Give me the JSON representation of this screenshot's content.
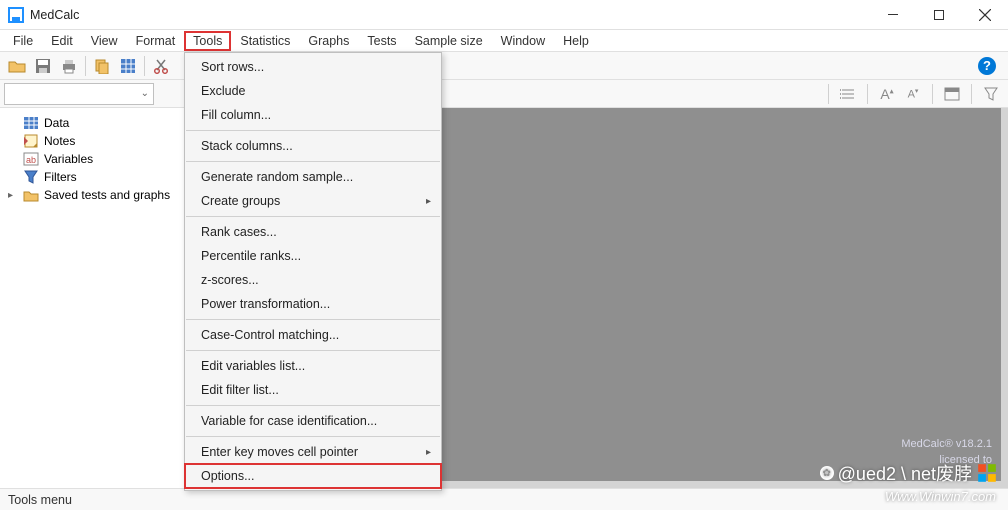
{
  "window": {
    "title": "MedCalc"
  },
  "menubar": {
    "items": [
      "File",
      "Edit",
      "View",
      "Format",
      "Tools",
      "Statistics",
      "Graphs",
      "Tests",
      "Sample size",
      "Window",
      "Help"
    ],
    "highlight_index": 4
  },
  "toolbar": {
    "icons": [
      "open-icon",
      "save-icon",
      "print-icon",
      "copy-icon",
      "paste-icon",
      "grid-icon",
      "cut-icon",
      "chart-icon",
      "undo-icon",
      "redo-icon"
    ],
    "help": "?"
  },
  "toolbar2": {
    "combo_value": "",
    "extra_icons": [
      "list-icon",
      "font-increase-icon",
      "font-decrease-icon",
      "table-style-icon",
      "filter-icon"
    ]
  },
  "sidebar": {
    "nodes": [
      {
        "icon": "data-icon",
        "label": "Data",
        "arrow": ""
      },
      {
        "icon": "notes-icon",
        "label": "Notes",
        "arrow": ""
      },
      {
        "icon": "variables-icon",
        "label": "Variables",
        "arrow": ""
      },
      {
        "icon": "filters-icon",
        "label": "Filters",
        "arrow": ""
      },
      {
        "icon": "saved-icon",
        "label": "Saved tests and graphs",
        "arrow": "▸"
      }
    ]
  },
  "dropdown": {
    "groups": [
      [
        "Sort rows...",
        "Exclude",
        "Fill column..."
      ],
      [
        "Stack columns..."
      ],
      [
        "Generate random sample...",
        {
          "label": "Create groups",
          "sub": true
        }
      ],
      [
        "Rank cases...",
        "Percentile ranks...",
        "z-scores...",
        "Power transformation..."
      ],
      [
        "Case-Control matching..."
      ],
      [
        "Edit variables list...",
        "Edit filter list..."
      ],
      [
        "Variable for case identification..."
      ],
      [
        {
          "label": "Enter key moves cell pointer",
          "sub": true
        },
        {
          "label": "Options...",
          "highlight": true
        }
      ]
    ]
  },
  "license": {
    "line1": "MedCalc® v18.2.1",
    "line2": "licensed to"
  },
  "statusbar": {
    "text": "Tools menu"
  },
  "watermark": {
    "main": "@ued2 \\ net废脖",
    "sub": "Www.Winwin7.com"
  }
}
